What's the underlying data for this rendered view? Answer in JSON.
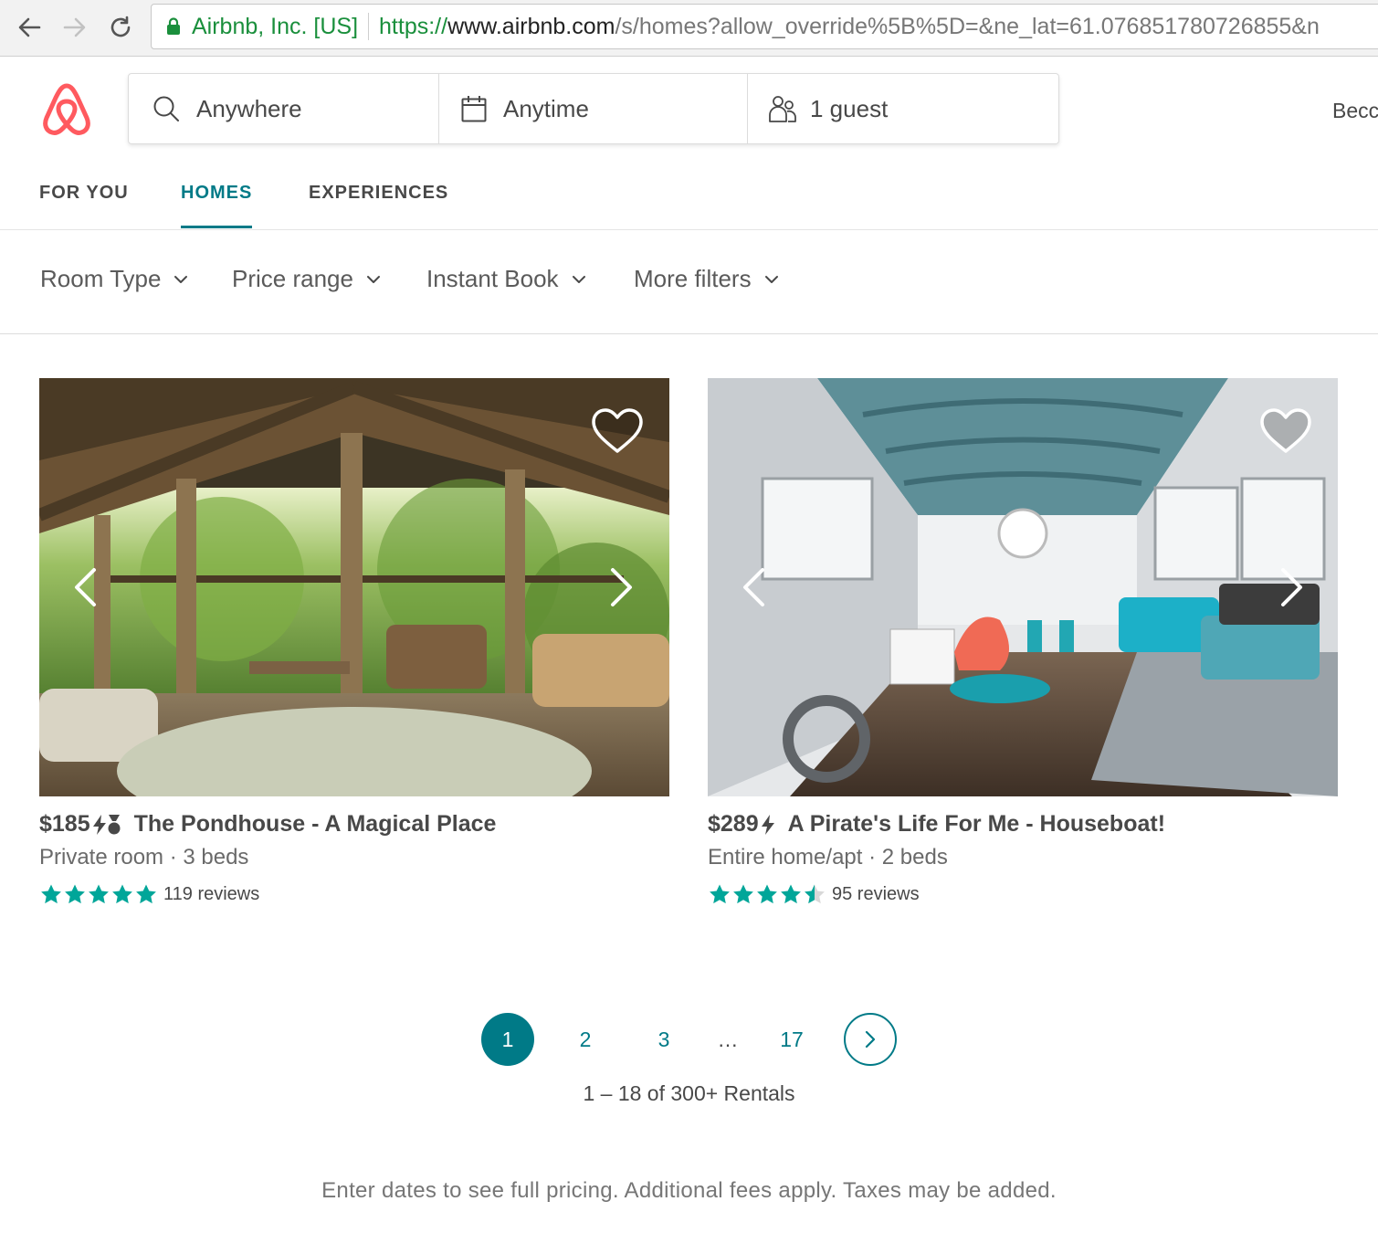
{
  "browser": {
    "company": "Airbnb, Inc. [US]",
    "url_scheme": "https://",
    "url_host": "www.airbnb.com",
    "url_path": "/s/homes?allow_override%5B%5D=&ne_lat=61.076851780726855&n"
  },
  "header": {
    "search": {
      "where": "Anywhere",
      "when": "Anytime",
      "guests": "1 guest"
    },
    "become_host": "Becc"
  },
  "tabs": [
    {
      "label": "FOR YOU",
      "active": false
    },
    {
      "label": "HOMES",
      "active": true
    },
    {
      "label": "EXPERIENCES",
      "active": false
    }
  ],
  "filters": [
    {
      "label": "Room Type"
    },
    {
      "label": "Price range"
    },
    {
      "label": "Instant Book"
    },
    {
      "label": "More filters"
    }
  ],
  "listings": [
    {
      "price": "$185",
      "badges": [
        "instant-book",
        "superhost"
      ],
      "title": "The Pondhouse - A Magical Place",
      "subtitle": "Private room · 3 beds",
      "rating": 5,
      "reviews": "119 reviews"
    },
    {
      "price": "$289",
      "badges": [
        "instant-book"
      ],
      "title": "A Pirate's Life For Me - Houseboat!",
      "subtitle": "Entire home/apt · 2 beds",
      "rating": 4.5,
      "reviews": "95 reviews"
    }
  ],
  "pagination": {
    "pages": [
      "1",
      "2",
      "3",
      "…",
      "17"
    ],
    "current": "1",
    "summary": "1 – 18 of 300+ Rentals"
  },
  "footer": {
    "disclaimer": "Enter dates to see full pricing. Additional fees apply. Taxes may be added."
  },
  "colors": {
    "brand": "#ff5a5f",
    "accent": "#007a87",
    "stars": "#00a699",
    "secure": "#1a8f3c"
  }
}
